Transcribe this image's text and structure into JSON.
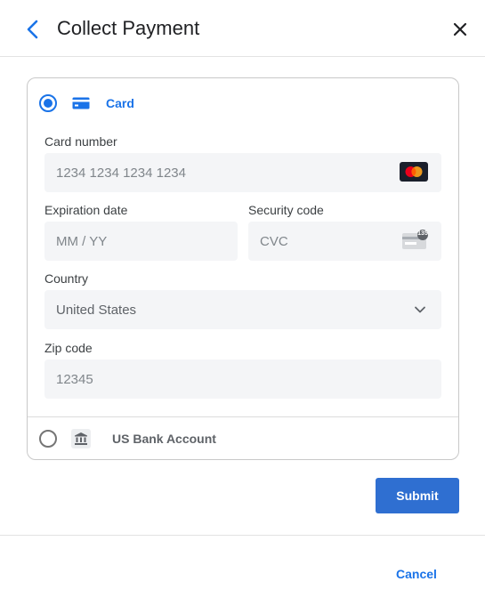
{
  "header": {
    "title": "Collect Payment",
    "back_icon": "chevron-left-icon",
    "close_icon": "close-icon"
  },
  "payment_methods": {
    "card": {
      "label": "Card",
      "selected": true,
      "icon": "credit-card-icon"
    },
    "bank": {
      "label": "US Bank Account",
      "selected": false,
      "icon": "bank-icon"
    }
  },
  "card_form": {
    "card_number": {
      "label": "Card number",
      "placeholder": "1234 1234 1234 1234",
      "brand_icon": "mastercard-icon"
    },
    "expiration": {
      "label": "Expiration date",
      "placeholder": "MM / YY"
    },
    "security_code": {
      "label": "Security code",
      "placeholder": "CVC",
      "badge": "135",
      "icon": "cvc-card-icon"
    },
    "country": {
      "label": "Country",
      "value": "United States"
    },
    "zip": {
      "label": "Zip code",
      "placeholder": "12345"
    }
  },
  "actions": {
    "submit_label": "Submit",
    "cancel_label": "Cancel"
  },
  "colors": {
    "accent": "#1a73e8",
    "submit_bg": "#2f6fd1",
    "field_bg": "#f4f5f7"
  }
}
